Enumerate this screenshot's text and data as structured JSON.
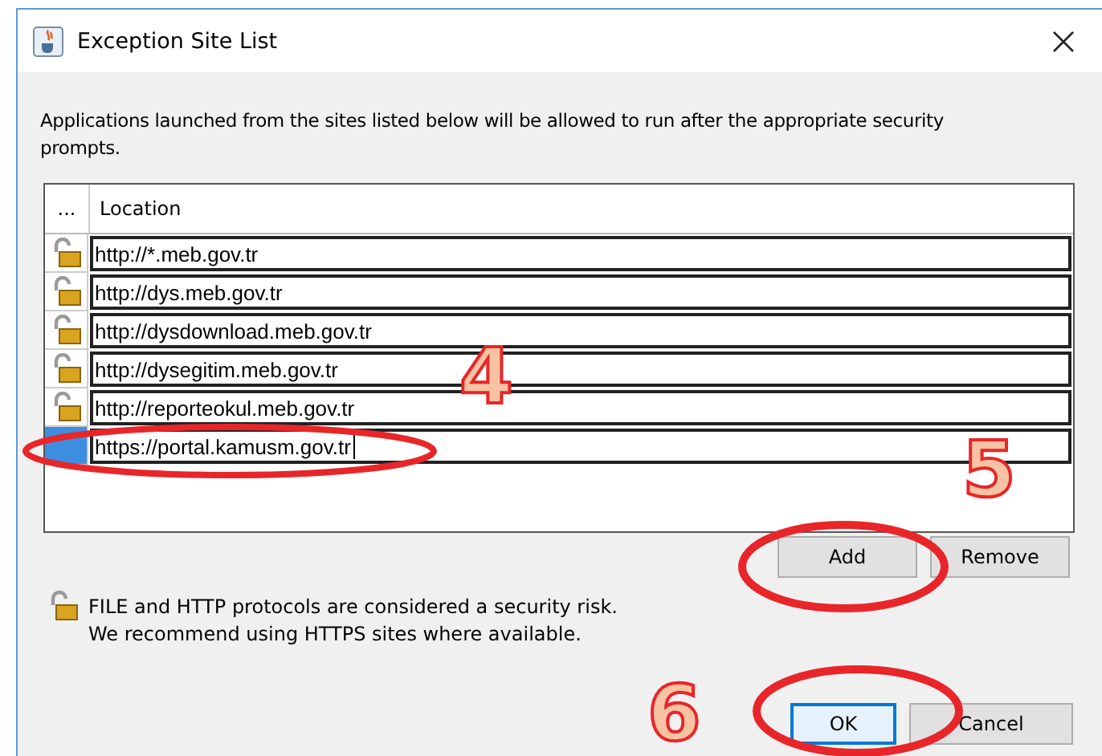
{
  "window": {
    "title": "Exception Site List"
  },
  "description": "Applications launched from the sites listed below will be allowed to run after the appropriate security prompts.",
  "table": {
    "columns": [
      "...",
      "Location"
    ],
    "rows": [
      {
        "location": "http://*.meb.gov.tr",
        "insecure": true,
        "selected": false
      },
      {
        "location": "http://dys.meb.gov.tr",
        "insecure": true,
        "selected": false
      },
      {
        "location": "http://dysdownload.meb.gov.tr",
        "insecure": true,
        "selected": false
      },
      {
        "location": "http://dysegitim.meb.gov.tr",
        "insecure": true,
        "selected": false
      },
      {
        "location": "http://reporteokul.meb.gov.tr",
        "insecure": true,
        "selected": false
      },
      {
        "location": "https://portal.kamusm.gov.tr",
        "insecure": false,
        "selected": true
      }
    ]
  },
  "table_buttons": [
    "Add",
    "Remove"
  ],
  "warning": [
    "FILE and HTTP protocols are considered a security risk.",
    "We recommend using HTTPS sites where available."
  ],
  "buttons": [
    {
      "label": "OK",
      "focused": true
    },
    {
      "label": "Cancel",
      "focused": false
    }
  ],
  "steps": [
    {
      "number": "4"
    },
    {
      "number": "5"
    },
    {
      "number": "6"
    }
  ]
}
